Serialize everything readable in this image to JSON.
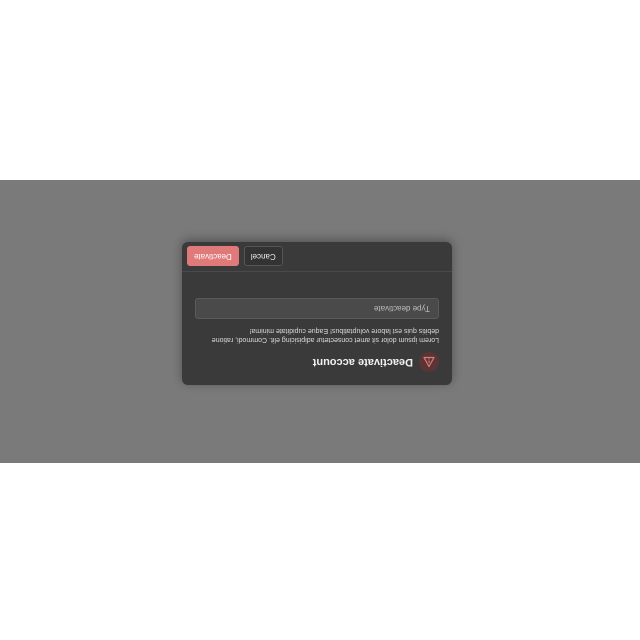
{
  "dialog": {
    "title": "Deactivate account",
    "icon": "warning-triangle-icon",
    "message": "Lorem ipsum dolor sit amet consectetur adipisicing elit. Commodi, ratione debitis quis est labore voluptatibus! Eaque cupiditate minima!",
    "input": {
      "value": "",
      "placeholder": "Type deactivate"
    },
    "actions": {
      "cancel_label": "Cancel",
      "deactivate_label": "Deactivate"
    }
  },
  "colors": {
    "backdrop": "#7a7a7a",
    "dialog_bg": "#3a3a3a",
    "danger": "#e07a7a",
    "icon_bg": "#5b3535"
  }
}
